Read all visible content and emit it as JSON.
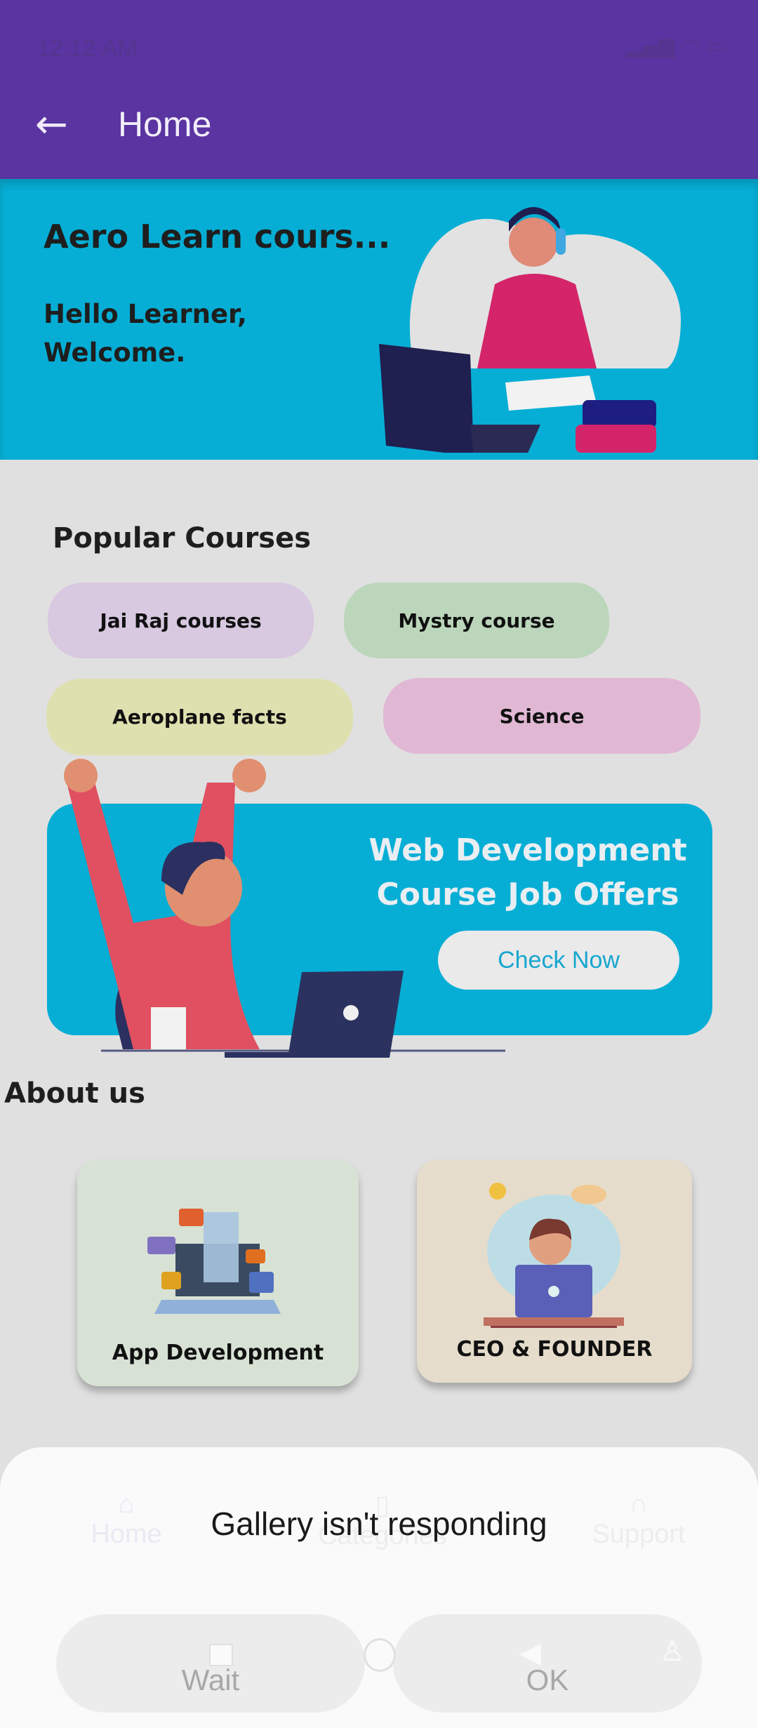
{
  "status_bar": {
    "time": "12:12 AM"
  },
  "app_bar": {
    "title": "Home",
    "back_icon": "arrow-left-icon",
    "color": "#5a34a0"
  },
  "hero": {
    "title": "Aero Learn cours...",
    "greeting_line1": "Hello Learner,",
    "greeting_line2": "Welcome.",
    "color": "#06aed5"
  },
  "popular": {
    "heading": "Popular Courses",
    "chips": [
      {
        "label": "Jai Raj courses",
        "color": "#d8c8e0"
      },
      {
        "label": "Mystry course",
        "color": "#bcd6bc"
      },
      {
        "label": "Aeroplane facts",
        "color": "#dfe0b0"
      },
      {
        "label": "Science",
        "color": "#e0b8d4"
      }
    ]
  },
  "promo": {
    "line1": "Web Development",
    "line2": "Course Job Offers",
    "button": "Check Now"
  },
  "about": {
    "heading": "About us",
    "cards": [
      {
        "label": "App Development",
        "color": "#d7e2d5"
      },
      {
        "label": "CEO & FOUNDER",
        "color": "#e6dccb"
      }
    ]
  },
  "bottom_nav": {
    "items": [
      {
        "label": "Home",
        "icon": "home-icon"
      },
      {
        "label": "Categories",
        "icon": "book-icon"
      },
      {
        "label": "Support",
        "icon": "headset-icon"
      }
    ]
  },
  "dialog": {
    "title": "Gallery isn't responding",
    "wait": "Wait",
    "ok": "OK"
  }
}
